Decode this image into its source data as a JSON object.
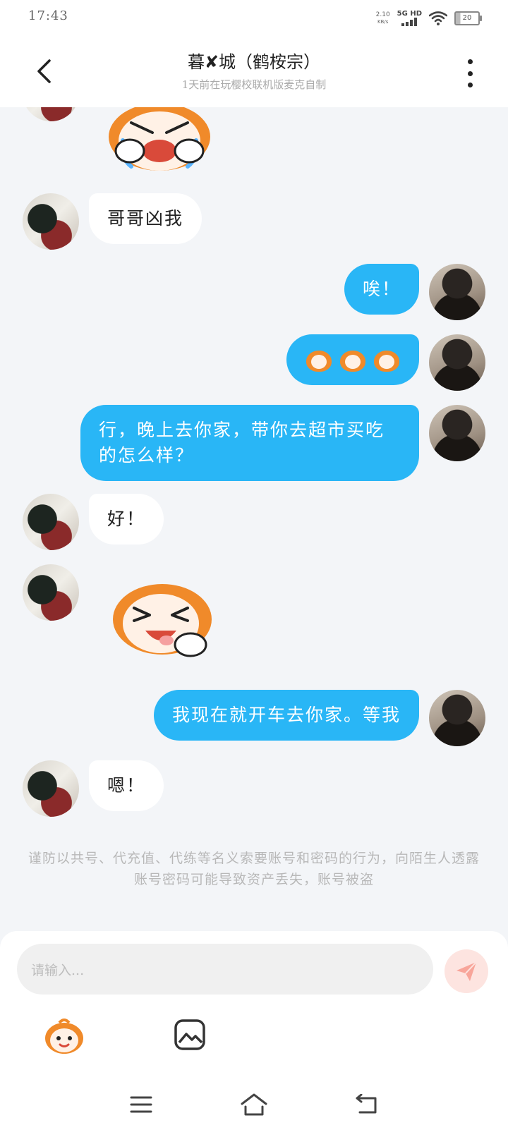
{
  "status_bar": {
    "time": "17:43",
    "net_speed": "2.10",
    "net_unit": "KB/s",
    "network": "5G HD",
    "battery": "20"
  },
  "header": {
    "title": "暮✘城（鹤桉宗）",
    "subtitle": "1天前在玩樱校联机版麦克自制"
  },
  "messages": [
    {
      "sender": "them",
      "type": "sticker",
      "sticker": "crying-face-sticker"
    },
    {
      "sender": "them",
      "type": "text",
      "text": "哥哥凶我"
    },
    {
      "sender": "me",
      "type": "text",
      "text": "唉！"
    },
    {
      "sender": "me",
      "type": "emoji",
      "emoji": [
        "smug-face-emoji",
        "smug-face-emoji",
        "smug-face-emoji"
      ]
    },
    {
      "sender": "me",
      "type": "text",
      "text": "行，晚上去你家，带你去超市买吃的怎么样？"
    },
    {
      "sender": "them",
      "type": "text",
      "text": "好！"
    },
    {
      "sender": "them",
      "type": "sticker",
      "sticker": "laughing-face-sticker"
    },
    {
      "sender": "me",
      "type": "text",
      "text": "我现在就开车去你家。等我"
    },
    {
      "sender": "them",
      "type": "text",
      "text": "嗯！"
    }
  ],
  "notice": "谨防以共号、代充值、代练等名义索要账号和密码的行为，向陌生人透露账号密码可能导致资产丢失，账号被盗",
  "input": {
    "placeholder": "请输入..."
  },
  "colors": {
    "my_bubble": "#29b6f6",
    "their_bubble": "#ffffff",
    "background": "#f3f5f8",
    "send_button": "#fde4e0"
  }
}
